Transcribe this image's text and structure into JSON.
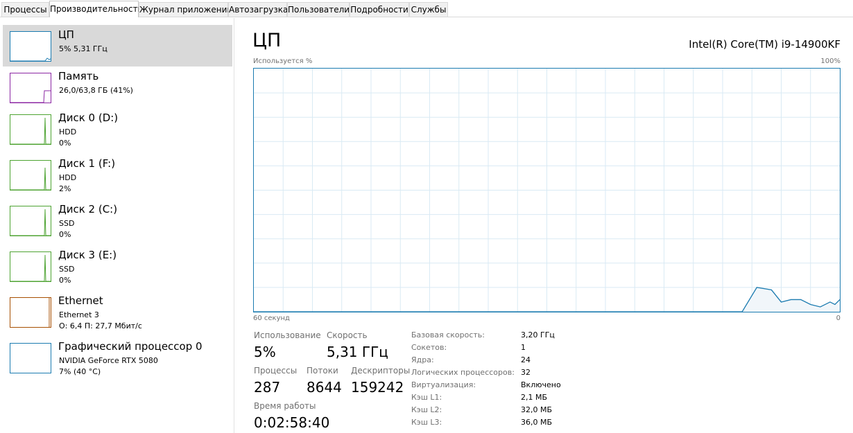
{
  "tabs": [
    {
      "label": "Процессы",
      "active": false
    },
    {
      "label": "Производительность",
      "active": true
    },
    {
      "label": "Журнал приложений",
      "active": false
    },
    {
      "label": "Автозагрузка",
      "active": false
    },
    {
      "label": "Пользователи",
      "active": false
    },
    {
      "label": "Подробности",
      "active": false
    },
    {
      "label": "Службы",
      "active": false
    }
  ],
  "sidebar": {
    "items": [
      {
        "name": "ЦП",
        "line2": "5% 5,31 ГГц",
        "line3": "",
        "color": "#1b7bb0",
        "selected": true
      },
      {
        "name": "Память",
        "line2": "26,0/63,8 ГБ (41%)",
        "line3": "",
        "color": "#8b26a3",
        "selected": false
      },
      {
        "name": "Диск 0 (D:)",
        "line2": "HDD",
        "line3": "0%",
        "color": "#4da331",
        "selected": false
      },
      {
        "name": "Диск 1 (F:)",
        "line2": "HDD",
        "line3": "2%",
        "color": "#4da331",
        "selected": false
      },
      {
        "name": "Диск 2 (C:)",
        "line2": "SSD",
        "line3": "0%",
        "color": "#4da331",
        "selected": false
      },
      {
        "name": "Диск 3 (E:)",
        "line2": "SSD",
        "line3": "0%",
        "color": "#4da331",
        "selected": false
      },
      {
        "name": "Ethernet",
        "line2": "Ethernet 3",
        "line3": "О: 6,4 П: 27,7 Мбит/с",
        "color": "#a74f01",
        "selected": false
      },
      {
        "name": "Графический процессор 0",
        "line2": "NVIDIA GeForce RTX 5080",
        "line3": "7% (40 °C)",
        "color": "#1b7bb0",
        "selected": false
      }
    ]
  },
  "main": {
    "title": "ЦП",
    "model": "Intel(R) Core(TM) i9-14900KF",
    "graph_label_top_left": "Используется %",
    "graph_label_top_right": "100%",
    "graph_label_bottom_left": "60 секунд",
    "graph_label_bottom_right": "0",
    "graph_line_color": "#1b7bb0",
    "grid_color": "#d9eaf4"
  },
  "cpu_usage_history": [
    {
      "seconds_ago": 60,
      "percent": 0
    },
    {
      "seconds_ago": 10,
      "percent": 0
    },
    {
      "seconds_ago": 8.5,
      "percent": 10
    },
    {
      "seconds_ago": 7,
      "percent": 9
    },
    {
      "seconds_ago": 6,
      "percent": 4
    },
    {
      "seconds_ago": 5,
      "percent": 5
    },
    {
      "seconds_ago": 4,
      "percent": 5
    },
    {
      "seconds_ago": 3,
      "percent": 3
    },
    {
      "seconds_ago": 2,
      "percent": 2
    },
    {
      "seconds_ago": 1,
      "percent": 4
    },
    {
      "seconds_ago": 0.5,
      "percent": 3
    },
    {
      "seconds_ago": 0,
      "percent": 5
    }
  ],
  "stats": {
    "usage_label": "Использование",
    "usage_value": "5%",
    "speed_label": "Скорость",
    "speed_value": "5,31 ГГц",
    "processes_label": "Процессы",
    "processes_value": "287",
    "threads_label": "Потоки",
    "threads_value": "8644",
    "handles_label": "Дескрипторы",
    "handles_value": "159242",
    "uptime_label": "Время работы",
    "uptime_value": "0:02:58:40"
  },
  "specs": [
    {
      "key": "Базовая скорость:",
      "value": "3,20 ГГц"
    },
    {
      "key": "Сокетов:",
      "value": "1"
    },
    {
      "key": "Ядра:",
      "value": "24"
    },
    {
      "key": "Логических процессоров:",
      "value": "32"
    },
    {
      "key": "Виртуализация:",
      "value": "Включено"
    },
    {
      "key": "Кэш L1:",
      "value": "2,1 МБ"
    },
    {
      "key": "Кэш L2:",
      "value": "32,0 МБ"
    },
    {
      "key": "Кэш L3:",
      "value": "36,0 МБ"
    }
  ]
}
